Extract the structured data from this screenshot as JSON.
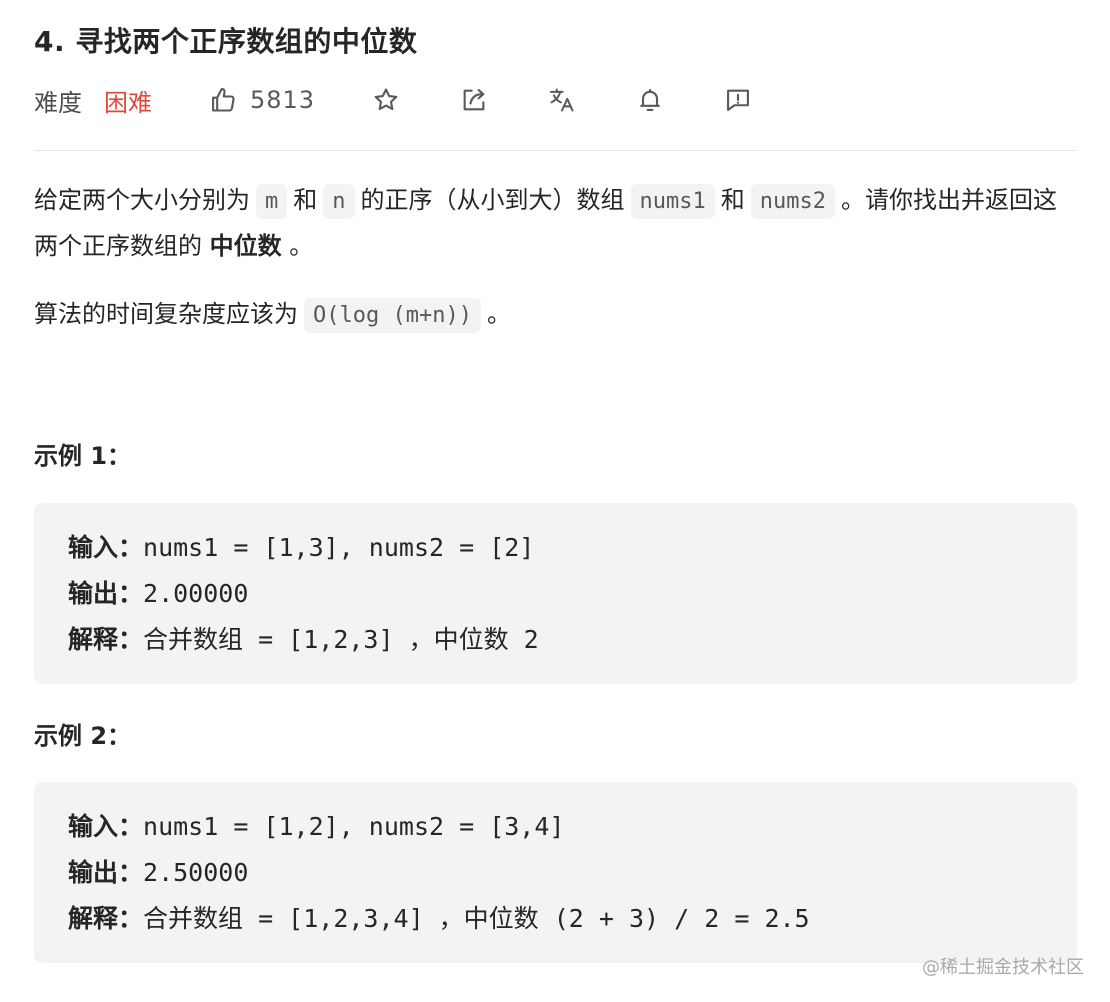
{
  "problem": {
    "title": "4. 寻找两个正序数组的中位数",
    "difficulty_label": "难度",
    "difficulty_value": "困难",
    "likes": "5813"
  },
  "icons": {
    "like": "thumbs-up-icon",
    "favorite": "star-icon",
    "share": "share-icon",
    "translate": "translate-icon",
    "notify": "bell-icon",
    "feedback": "feedback-icon"
  },
  "description": {
    "p1_part1": "给定两个大小分别为",
    "p1_code_m": "m",
    "p1_and1": "和",
    "p1_code_n": "n",
    "p1_part2": "的正序（从小到大）数组",
    "p1_code_nums1": "nums1",
    "p1_and2": "和",
    "p1_code_nums2": "nums2",
    "p1_part3": "。请你找出并返回这两个正序数组的",
    "p1_bold": "中位数",
    "p1_end": "。",
    "p2_part1": "算法的时间复杂度应该为",
    "p2_code": "O(log (m+n))",
    "p2_end": "。"
  },
  "examples": [
    {
      "heading": "示例 1：",
      "input_label": "输入：",
      "input": "nums1 = [1,3], nums2 = [2]",
      "output_label": "输出：",
      "output": "2.00000",
      "explain_label": "解释：",
      "explain": "合并数组 = [1,2,3] ，中位数 2"
    },
    {
      "heading": "示例 2：",
      "input_label": "输入：",
      "input": "nums1 = [1,2], nums2 = [3,4]",
      "output_label": "输出：",
      "output": "2.50000",
      "explain_label": "解释：",
      "explain": "合并数组 = [1,2,3,4] ，中位数 (2 + 3) / 2 = 2.5"
    }
  ],
  "watermark": "@稀土掘金技术社区",
  "colors": {
    "difficulty_hard": "#e0483e",
    "code_bg": "#f3f3f4",
    "text": "#262626"
  }
}
